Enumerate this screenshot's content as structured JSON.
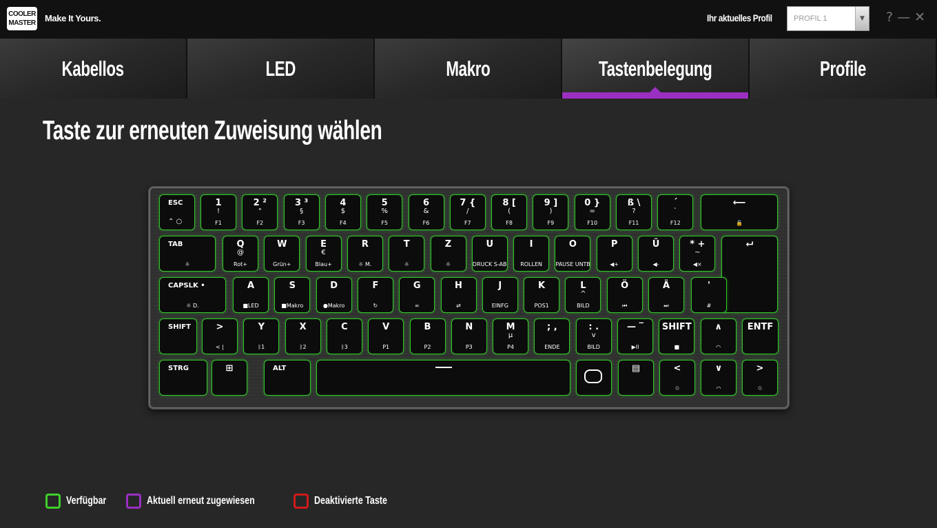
{
  "header": {
    "logo_text": "COOLER MASTER",
    "slogan": "Make It Yours.",
    "profile_label": "Ihr aktuelles Profil",
    "profile_value": "PROFIL 1",
    "help_icon": "help-icon",
    "minimize_icon": "minimize-icon",
    "close_icon": "close-icon"
  },
  "tabs": [
    {
      "label": "Kabellos",
      "active": false
    },
    {
      "label": "LED",
      "active": false
    },
    {
      "label": "Makro",
      "active": false
    },
    {
      "label": "Tastenbelegung",
      "active": true
    },
    {
      "label": "Profile",
      "active": false
    }
  ],
  "main": {
    "title": "Taste zur erneuten Zuweisung wählen"
  },
  "keyboard": {
    "rows": [
      [
        {
          "id": "esc",
          "tl": "ESC",
          "bl": "⌃ ○"
        },
        {
          "id": "1",
          "t": "1",
          "m": "!",
          "b": "F1"
        },
        {
          "id": "2",
          "t": "2 ²",
          "m": "\"",
          "b": "F2"
        },
        {
          "id": "3",
          "t": "3 ³",
          "m": "§",
          "b": "F3"
        },
        {
          "id": "4",
          "t": "4",
          "m": "$",
          "b": "F4"
        },
        {
          "id": "5",
          "t": "5",
          "m": "%",
          "b": "F5"
        },
        {
          "id": "6",
          "t": "6",
          "m": "&",
          "b": "F6"
        },
        {
          "id": "7",
          "t": "7 {",
          "m": "/",
          "b": "F7"
        },
        {
          "id": "8",
          "t": "8 [",
          "m": "(",
          "b": "F8"
        },
        {
          "id": "9",
          "t": "9 ]",
          "m": ")",
          "b": "F9"
        },
        {
          "id": "0",
          "t": "0 }",
          "m": "=",
          "b": "F10"
        },
        {
          "id": "sz",
          "t": "ß \\",
          "m": "?",
          "b": "F11"
        },
        {
          "id": "acute",
          "t": "´",
          "m": "`",
          "b": "F12"
        },
        {
          "id": "backspace",
          "t": "⟵",
          "b": "🔒"
        }
      ],
      [
        {
          "id": "tab",
          "tl": "TAB",
          "b": "☼"
        },
        {
          "id": "q",
          "t": "Q",
          "m": "@",
          "b": "Rot+"
        },
        {
          "id": "w",
          "t": "W",
          "b": "Grün+"
        },
        {
          "id": "e",
          "t": "E",
          "m": "€",
          "b": "Blau+"
        },
        {
          "id": "r",
          "t": "R",
          "b": "☼ M."
        },
        {
          "id": "t",
          "t": "T",
          "b": "☼"
        },
        {
          "id": "z",
          "t": "Z",
          "b": "☼"
        },
        {
          "id": "u",
          "t": "U",
          "b": "DRUCK S-ABF"
        },
        {
          "id": "i",
          "t": "I",
          "b": "ROLLEN"
        },
        {
          "id": "o",
          "t": "O",
          "b": "PAUSE UNTBR"
        },
        {
          "id": "p",
          "t": "P",
          "b": "◀+"
        },
        {
          "id": "ue",
          "t": "Ü",
          "b": "◀-"
        },
        {
          "id": "plus",
          "t": "* +",
          "m": "~",
          "b": "◀×"
        },
        {
          "id": "enter",
          "t": "⮠"
        }
      ],
      [
        {
          "id": "capslk",
          "tl": "CAPSLK  •",
          "b": "☼ D."
        },
        {
          "id": "a",
          "t": "A",
          "b": "■LED"
        },
        {
          "id": "s",
          "t": "S",
          "b": "■Makro"
        },
        {
          "id": "d",
          "t": "D",
          "b": "●Makro"
        },
        {
          "id": "f",
          "t": "F",
          "b": "↻"
        },
        {
          "id": "g",
          "t": "G",
          "b": "∞"
        },
        {
          "id": "h",
          "t": "H",
          "b": "⇄"
        },
        {
          "id": "j",
          "t": "J",
          "b": "EINFG"
        },
        {
          "id": "k",
          "t": "K",
          "b": "POS1"
        },
        {
          "id": "l",
          "t": "L",
          "m": "^",
          "b": "BILD"
        },
        {
          "id": "oe",
          "t": "Ö",
          "b": "⏮"
        },
        {
          "id": "ae",
          "t": "Ä",
          "b": "⏭"
        },
        {
          "id": "hash",
          "t": "'",
          "b": "#"
        }
      ],
      [
        {
          "id": "lshift",
          "tl": "SHIFT"
        },
        {
          "id": "lt",
          "t": ">",
          "b": "<  |"
        },
        {
          "id": "y",
          "t": "Y",
          "b": "ᛒ1"
        },
        {
          "id": "x",
          "t": "X",
          "b": "ᛒ2"
        },
        {
          "id": "c",
          "t": "C",
          "b": "ᛒ3"
        },
        {
          "id": "v",
          "t": "V",
          "b": "P1"
        },
        {
          "id": "b",
          "t": "B",
          "b": "P2"
        },
        {
          "id": "n",
          "t": "N",
          "b": "P3"
        },
        {
          "id": "m",
          "t": "M",
          "m": "μ",
          "b": "P4"
        },
        {
          "id": "comma",
          "t": ";  ,",
          "b": "ENDE"
        },
        {
          "id": "period",
          "t": ":  .",
          "m": "v",
          "b": "BILD"
        },
        {
          "id": "minus",
          "t": "—  ‾",
          "b": "▶II"
        },
        {
          "id": "rshift",
          "t": "SHIFT",
          "b": "■"
        },
        {
          "id": "up",
          "t": "∧",
          "b": "◠"
        },
        {
          "id": "entf",
          "t": "ENTF"
        }
      ],
      [
        {
          "id": "strg",
          "tl": "STRG"
        },
        {
          "id": "win",
          "t": "⊞"
        },
        {
          "id": "alt",
          "tl": "ALT"
        },
        {
          "id": "space",
          "t": ""
        },
        {
          "id": "fn",
          "t": "⬡"
        },
        {
          "id": "menu",
          "t": "▤"
        },
        {
          "id": "left",
          "t": "<",
          "b": "♲"
        },
        {
          "id": "down",
          "t": "∨",
          "b": "◠"
        },
        {
          "id": "right",
          "t": ">",
          "b": "♲"
        }
      ]
    ]
  },
  "legend": [
    {
      "label": "Verfügbar",
      "color": "#3fd02a"
    },
    {
      "label": "Aktuell erneut zugewiesen",
      "color": "#9b2fc2"
    },
    {
      "label": "Deaktivierte Taste",
      "color": "#d01a1a"
    }
  ]
}
